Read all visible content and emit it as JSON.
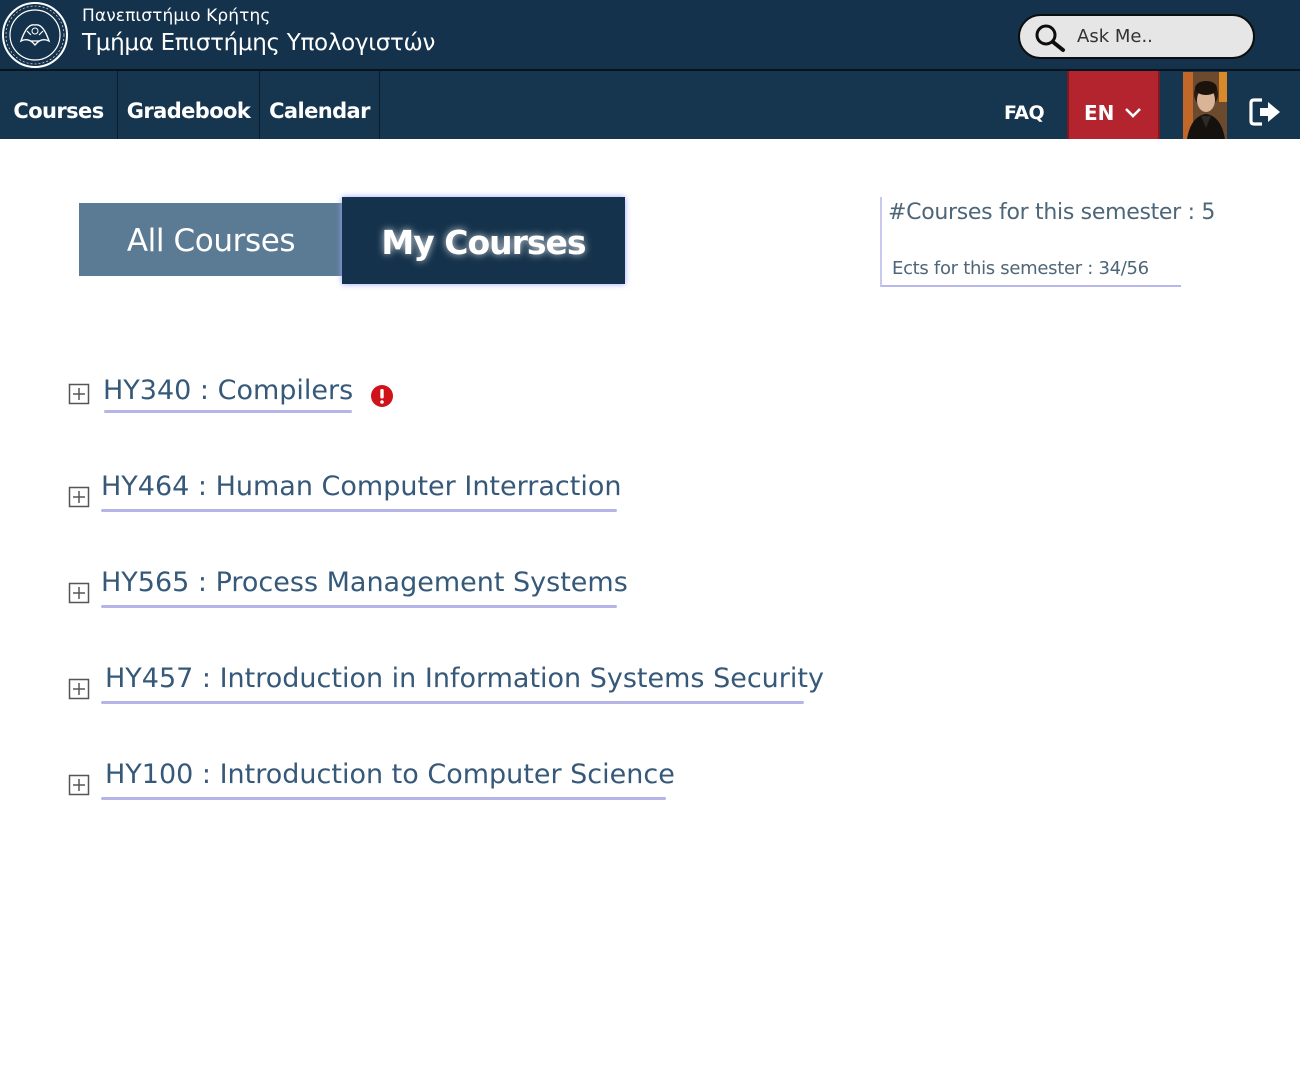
{
  "header": {
    "university": "Πανεπιστήμιο Κρήτης",
    "department": "Τμήμα Επιστήμης Υπολογιστών",
    "logo_icon": "university-seal-icon",
    "search": {
      "placeholder": "Ask Me..",
      "icon": "search-icon"
    }
  },
  "nav": {
    "items": [
      {
        "label": "Courses"
      },
      {
        "label": "Gradebook"
      },
      {
        "label": "Calendar"
      }
    ],
    "faq_label": "FAQ",
    "language": "EN",
    "language_icon": "chevron-down-icon",
    "logout_icon": "logout-icon"
  },
  "tabs": {
    "all_courses": "All Courses",
    "my_courses": "My Courses",
    "active": "my_courses"
  },
  "stats": {
    "courses_text": "#Courses for this semester : 5",
    "ects_text": "Ects for this semester : 34/56"
  },
  "courses": [
    {
      "title": "HY340 : Compilers",
      "alert": true
    },
    {
      "title": "HY464 : Human Computer Interraction",
      "alert": false
    },
    {
      "title": "HY565 : Process Management Systems",
      "alert": false
    },
    {
      "title": "HY457 : Introduction in Information Systems Security",
      "alert": false
    },
    {
      "title": "HY100 : Introduction to Computer Science",
      "alert": false
    }
  ],
  "colors": {
    "header_bg": "#14324b",
    "lang_bg": "#b3242f",
    "tab_inactive": "#5b7b94",
    "course_text": "#36597a",
    "alert": "#d0121b"
  }
}
